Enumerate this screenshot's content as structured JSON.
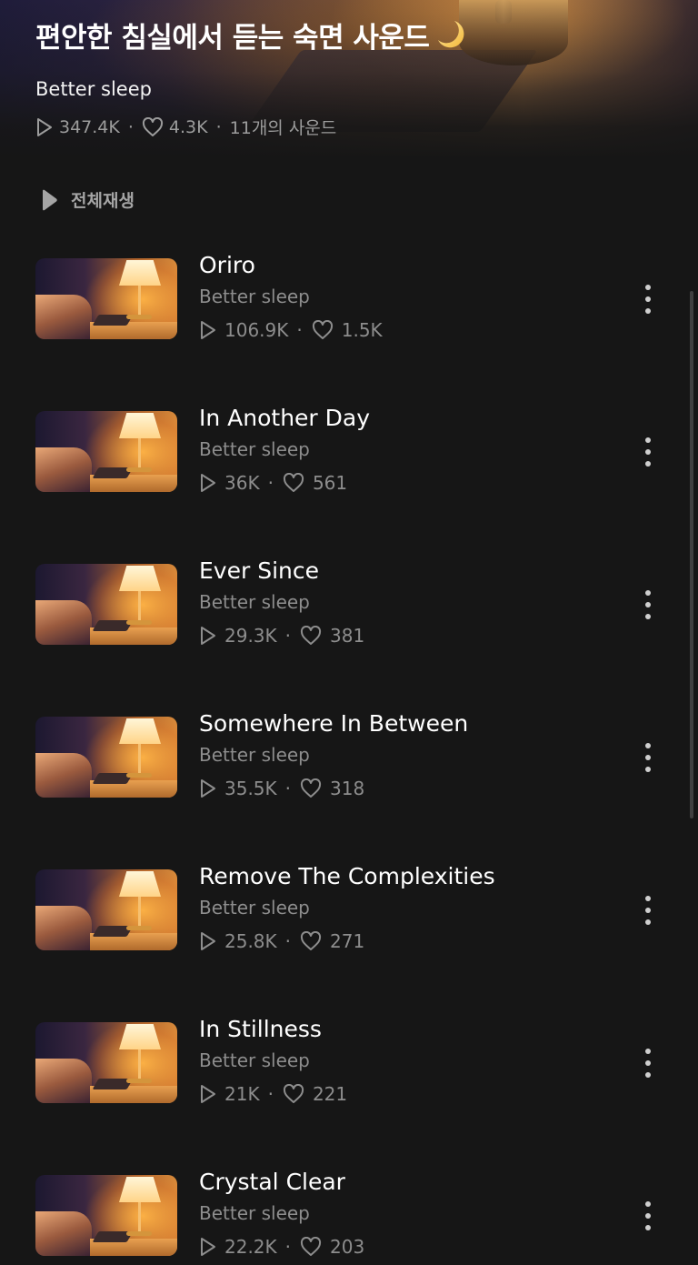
{
  "header": {
    "title": "편안한 침실에서 듣는 숙면 사운드",
    "title_emoji_icon": "crescent-moon-icon",
    "artist": "Better sleep",
    "plays": "347.4K",
    "likes": "4.3K",
    "sound_count": "11개의 사운드"
  },
  "play_all": {
    "label": "전체재생"
  },
  "tracks": [
    {
      "title": "Oriro",
      "artist": "Better sleep",
      "plays": "106.9K",
      "likes": "1.5K"
    },
    {
      "title": "In Another Day",
      "artist": "Better sleep",
      "plays": "36K",
      "likes": "561"
    },
    {
      "title": "Ever Since",
      "artist": "Better sleep",
      "plays": "29.3K",
      "likes": "381"
    },
    {
      "title": "Somewhere In Between",
      "artist": "Better sleep",
      "plays": "35.5K",
      "likes": "318"
    },
    {
      "title": "Remove The Complexities",
      "artist": "Better sleep",
      "plays": "25.8K",
      "likes": "271"
    },
    {
      "title": "In Stillness",
      "artist": "Better sleep",
      "plays": "21K",
      "likes": "221"
    },
    {
      "title": "Crystal Clear",
      "artist": "Better sleep",
      "plays": "22.2K",
      "likes": "203"
    }
  ],
  "separator": "·",
  "colors": {
    "background": "#161616",
    "muted_text": "#8d8d8d",
    "title_text": "#ffffff"
  }
}
